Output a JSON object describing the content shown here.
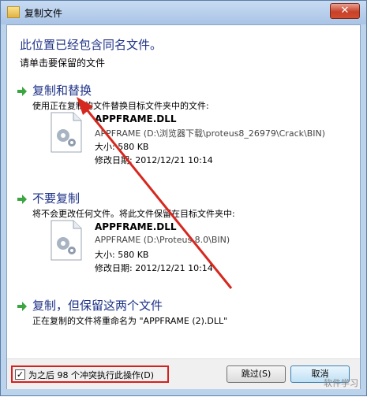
{
  "window": {
    "title": "复制文件",
    "close_label": "✕"
  },
  "dialog": {
    "heading": "此位置已经包含同名文件。",
    "subheading": "请单击要保留的文件"
  },
  "options": [
    {
      "title": "复制和替换",
      "description": "使用正在复制的文件替换目标文件夹中的文件:",
      "file_name": "APPFRAME.DLL",
      "file_path": "APPFRAME (D:\\浏览器下载\\proteus8_26979\\Crack\\BIN)",
      "file_size": "大小: 580 KB",
      "file_date": "修改日期: 2012/12/21 10:14"
    },
    {
      "title": "不要复制",
      "description": "将不会更改任何文件。将此文件保留在目标文件夹中:",
      "file_name": "APPFRAME.DLL",
      "file_path": "APPFRAME (D:\\Proteus 8.0\\BIN)",
      "file_size": "大小: 580 KB",
      "file_date": "修改日期: 2012/12/21 10:14"
    },
    {
      "title": "复制，但保留这两个文件",
      "description": "正在复制的文件将重命名为 \"APPFRAME (2).DLL\""
    }
  ],
  "footer": {
    "checkbox_label": "为之后 98 个冲突执行此操作(D)",
    "checkbox_checked": true,
    "checkbox_mark": "✓",
    "skip_label": "跳过(S)",
    "cancel_label": "取消"
  },
  "watermark": "软件学习"
}
